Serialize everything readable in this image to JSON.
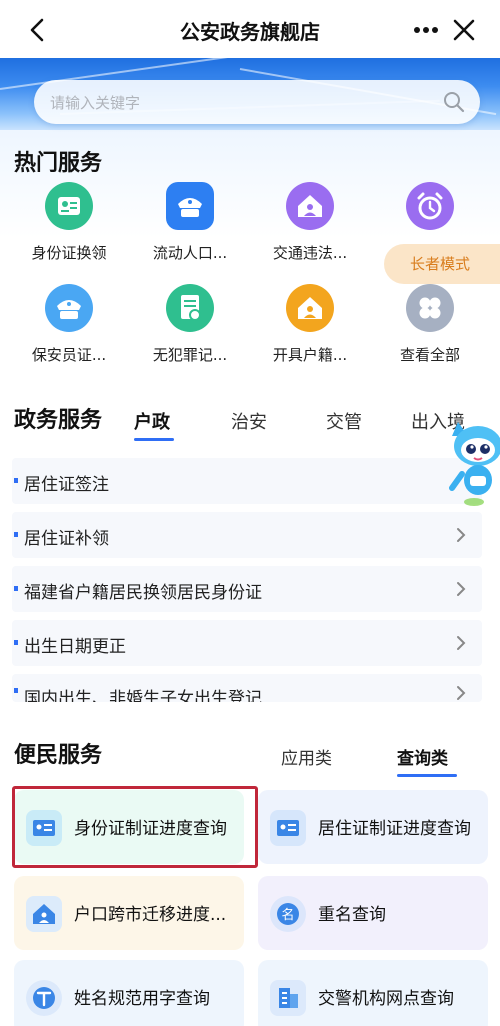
{
  "header": {
    "title": "公安政务旗舰店"
  },
  "search": {
    "placeholder": "请输入关键字"
  },
  "hot": {
    "title": "热门服务",
    "items": [
      {
        "label": "身份证换领",
        "icon": "id-card-icon",
        "color": "#2fbf8f"
      },
      {
        "label": "流动人口...",
        "icon": "police-cap-icon",
        "color": "#2d7ff2"
      },
      {
        "label": "交通违法...",
        "icon": "house-person-icon",
        "color": "#9a6df0"
      },
      {
        "label": "",
        "icon": "alarm-clock-icon",
        "color": "#9a6df0"
      },
      {
        "label": "保安员证...",
        "icon": "police-cap-icon",
        "color": "#4aa7f3"
      },
      {
        "label": "无犯罪记...",
        "icon": "document-icon",
        "color": "#2fbf8f"
      },
      {
        "label": "开具户籍...",
        "icon": "house-person-icon",
        "color": "#f3a51e"
      },
      {
        "label": "查看全部",
        "icon": "grid-icon",
        "color": "#a6b0c2"
      }
    ],
    "elder_mode": "长者模式"
  },
  "gov": {
    "title": "政务服务",
    "tabs": [
      "户政",
      "治安",
      "交管",
      "出入境"
    ],
    "active_tab": "户政",
    "rows": [
      "居住证签注",
      "居住证补领",
      "福建省户籍居民换领居民身份证",
      "出生日期更正",
      "国内出生、非婚生子女出生登记"
    ]
  },
  "conv": {
    "title": "便民服务",
    "tabs": [
      "应用类",
      "查询类"
    ],
    "active_tab": "查询类",
    "cards": [
      {
        "label": "身份证制证进度查询",
        "icon": "id-card-icon",
        "bg": "#eafaf4"
      },
      {
        "label": "居住证制证进度查询",
        "icon": "id-card-icon",
        "bg": "#eef3fd"
      },
      {
        "label": "户口跨市迁移进度...",
        "icon": "house-person-icon",
        "bg": "#fdf6e8"
      },
      {
        "label": "重名查询",
        "icon": "name-icon",
        "bg": "#f2f0fc"
      },
      {
        "label": "姓名规范用字查询",
        "icon": "text-icon",
        "bg": "#eef5fd"
      },
      {
        "label": "交警机构网点查询",
        "icon": "building-icon",
        "bg": "#eef5fd"
      }
    ]
  },
  "colors": {
    "accent": "#2f6ef5",
    "highlight": "#c0273a",
    "elder": "#d97e1f"
  }
}
